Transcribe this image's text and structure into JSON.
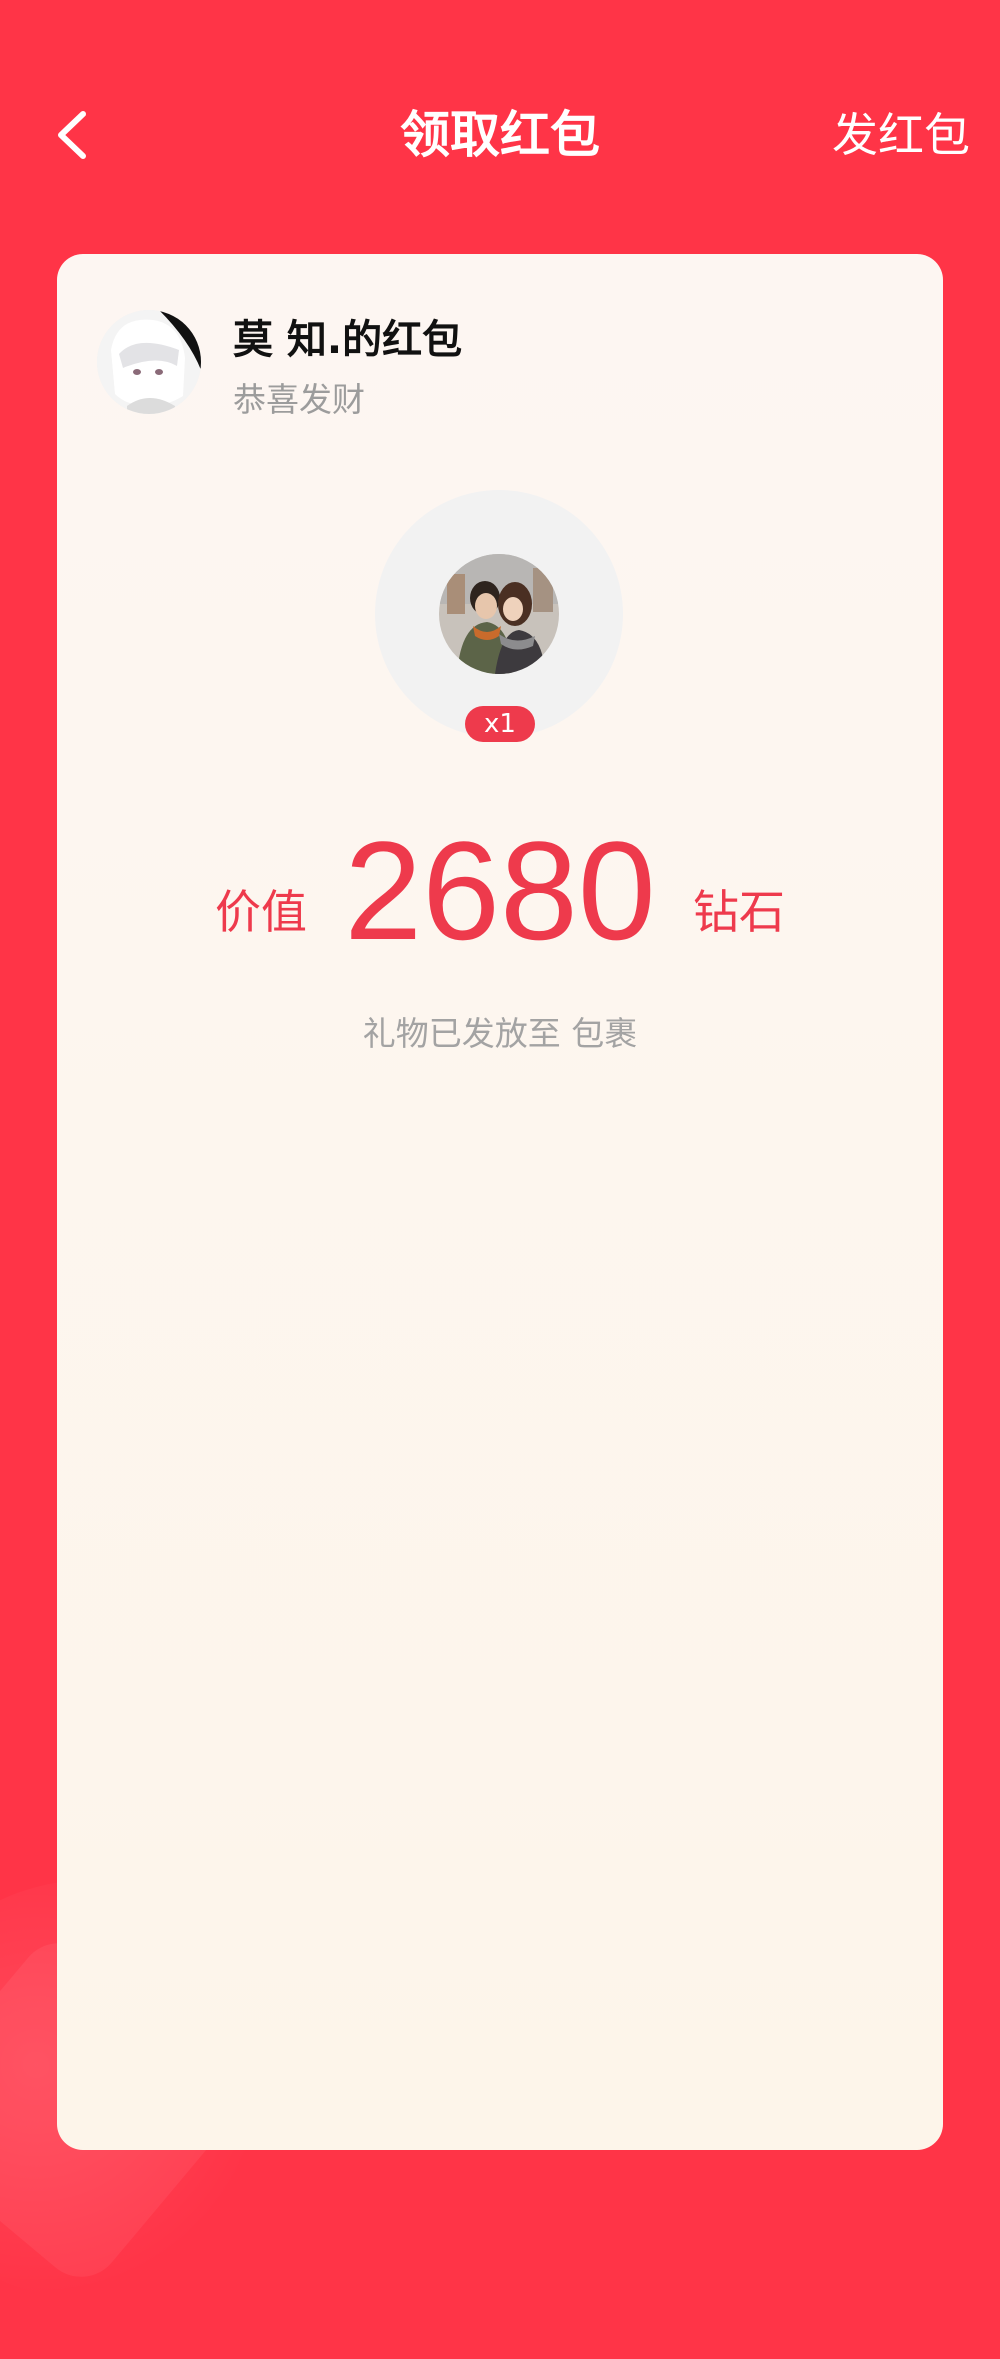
{
  "header": {
    "title": "领取红包",
    "send_label": "发红包"
  },
  "card": {
    "sender_name": "莫 知.的红包",
    "blessing": "恭喜发财",
    "gift": {
      "quantity": "x1"
    },
    "value": {
      "prefix": "价值",
      "amount": "2680",
      "unit": "钻石"
    },
    "delivery_note": "礼物已发放至 包裹"
  },
  "colors": {
    "background": "#ff3447",
    "accent": "#ee3a4c",
    "card": "#fdf6f2"
  },
  "icons": {
    "back": "chevron-left-icon"
  }
}
